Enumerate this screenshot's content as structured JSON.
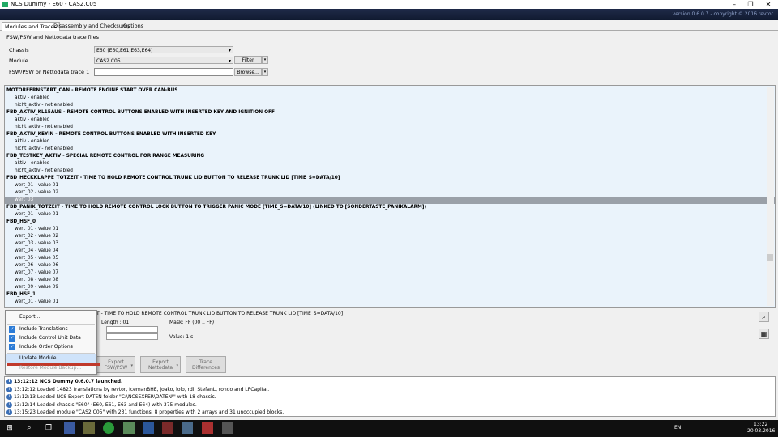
{
  "window": {
    "title": "NCS Dummy - E60 - CAS2.C05",
    "banner_version": "version 0.6.0.7 - copyright © 2016 revtor",
    "min_symbol": "–",
    "max_symbol": "❐",
    "close_symbol": "✕"
  },
  "tabs": [
    "Modules and Traces",
    "Disassembly and Checksums",
    "Options"
  ],
  "fsw": {
    "group_label": "FSW/PSW and Nettodata trace files",
    "chassis_label": "Chassis",
    "chassis_value": "E60  (E60,E61,E63,E64)",
    "module_label": "Module",
    "module_value": "CAS2.C05",
    "trace_label": "FSW/PSW or Nettodata trace 1",
    "filter_label": "Filter",
    "browse_label": "Browse...",
    "dropdown_arrow": "▾"
  },
  "tree": {
    "rows": [
      {
        "t": "MOTORFERNSTART_CAN  -  REMOTE ENGINE START OVER CAN-BUS",
        "head": true
      },
      {
        "t": "aktiv  -  enabled"
      },
      {
        "t": "nicht_aktiv  -  not enabled"
      },
      {
        "t": "FBD_AKTIV_KL15AUS  -  REMOTE CONTROL BUTTONS ENABLED WITH INSERTED KEY AND IGNITION OFF",
        "head": true
      },
      {
        "t": "aktiv  -  enabled"
      },
      {
        "t": "nicht_aktiv  -  not enabled"
      },
      {
        "t": "FBD_AKTIV_KEYIN  -  REMOTE CONTROL BUTTONS ENABLED WITH INSERTED KEY",
        "head": true
      },
      {
        "t": "aktiv  -  enabled"
      },
      {
        "t": "nicht_aktiv  -  not enabled"
      },
      {
        "t": "FBD_TESTKEY_AKTIV  -  SPECIAL REMOTE CONTROL FOR RANGE MEASURING",
        "head": true
      },
      {
        "t": "aktiv  -  enabled"
      },
      {
        "t": "nicht_aktiv  -  not enabled"
      },
      {
        "t": "FBD_HECKKLAPPE_TOTZEIT  -  TIME TO HOLD REMOTE CONTROL TRUNK LID BUTTON TO RELEASE TRUNK LID [TIME_S=DATA/10]",
        "head": true
      },
      {
        "t": "wert_01  -  value 01"
      },
      {
        "t": "wert_02  -  value 02"
      },
      {
        "t": "wert_03",
        "sel": true
      },
      {
        "t": "FBD_PANIK_TOTZEIT  -  TIME TO HOLD REMOTE CONTROL LOCK BUTTON TO TRIGGER PANIC MODE [TIME_S=DATA/10] (LINKED TO [SONDERTASTE_PANIKALARM])",
        "head": true
      },
      {
        "t": "wert_01  -  value 01"
      },
      {
        "t": "FBD_HSF_0",
        "head": true
      },
      {
        "t": "wert_01  -  value 01"
      },
      {
        "t": "wert_02  -  value 02"
      },
      {
        "t": "wert_03  -  value 03"
      },
      {
        "t": "wert_04  -  value 04"
      },
      {
        "t": "wert_05  -  value 05"
      },
      {
        "t": "wert_06  -  value 06"
      },
      {
        "t": "wert_07  -  value 07"
      },
      {
        "t": "wert_08  -  value 08"
      },
      {
        "t": "wert_09  -  value 09"
      },
      {
        "t": "FBD_HSF_1",
        "head": true
      },
      {
        "t": "wert_01  -  value 01"
      }
    ]
  },
  "info": {
    "description": "T  -  TIME TO HOLD REMOTE CONTROL TRUNK LID BUTTON TO RELEASE TRUNK LID [TIME_S=DATA/10]",
    "length": "Length :   01",
    "mask": "Mask:   FF  (00 .. FF)",
    "value": "Value:    1 s",
    "search_icon": "⌕",
    "grid_icon": "▦"
  },
  "menu": {
    "export": "Export...",
    "include_translations": "Include Translations",
    "include_control_unit_data": "Include Control Unit Data",
    "include_order_options": "Include Order Options",
    "update_module": "Update Module...",
    "restore_module_backup": "Restore Module Backup...",
    "check": "✓"
  },
  "actions": [
    {
      "line1": "Export",
      "line2": "FSW/PSW"
    },
    {
      "line1": "Export",
      "line2": "Nettodata"
    },
    {
      "line1": "Trace",
      "line2": "Differences"
    }
  ],
  "log": [
    {
      "t": "13:12:12  NCS Dummy 0.6.0.7 launched.",
      "bold": true
    },
    {
      "t": "13:12:12  Loaded 14823 translations by revtor, IcemanBHE, joako, lolo, rdi, StefanL, rondo and LPCapital."
    },
    {
      "t": "13:12:13  Loaded NCS Expert DATEN folder \"C:\\NCSEXPER\\DATEN\\\" with 18 chassis."
    },
    {
      "t": "13:12:14  Loaded chassis \"E60\" (E60, E61, E63 and E64) with 375 modules."
    },
    {
      "t": "13:15:23  Loaded module \"CAS2.C05\" with 231 functions, 8 properties with 2 arrays and 31 unoccupied blocks."
    }
  ],
  "log_icon": "i",
  "taskbar": {
    "lang": "EN",
    "time": "13:22",
    "date": "20.03.2016",
    "start_icon": "⊞",
    "search_icon": "⌕",
    "taskview_icon": "❐"
  }
}
